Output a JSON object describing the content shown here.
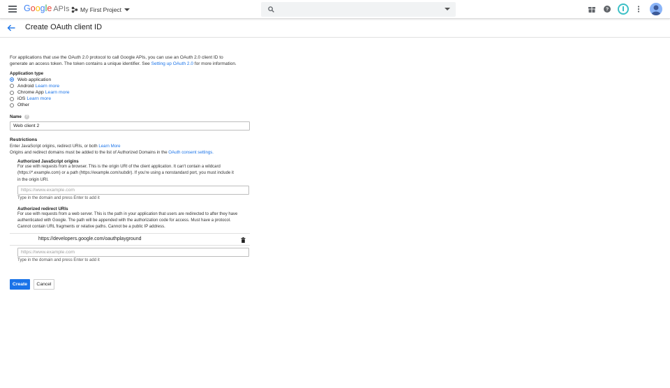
{
  "header": {
    "logo_text": "Google",
    "logo_suffix": "APIs",
    "project_name": "My First Project",
    "icons": [
      "menu-icon",
      "project-icon",
      "search-icon",
      "gift-icon",
      "help-icon",
      "notification-icon",
      "more-vert-icon",
      "avatar"
    ]
  },
  "page": {
    "title": "Create OAuth client ID"
  },
  "intro": {
    "text1": "For applications that use the OAuth 2.0 protocol to call Google APIs, you can use an OAuth 2.0 client ID to",
    "text2": "generate an access token. The token contains a unique identifier. See ",
    "link": "Setting up OAuth 2.0",
    "text3": " for more information."
  },
  "application_type": {
    "label": "Application type",
    "selected": "Web application",
    "options": [
      {
        "label": "Web application",
        "link": ""
      },
      {
        "label": "Android ",
        "link": "Learn more"
      },
      {
        "label": "Chrome App ",
        "link": "Learn more"
      },
      {
        "label": "iOS ",
        "link": "Learn more"
      },
      {
        "label": "Other",
        "link": ""
      }
    ]
  },
  "name": {
    "label": "Name",
    "value": "Web client 2"
  },
  "restrictions": {
    "title": "Restrictions",
    "line1": "Enter JavaScript origins, redirect URIs, or both ",
    "line1_link": "Learn More",
    "line2": "Origins and redirect domains must be added to the list of Authorized Domains in the ",
    "line2_link": "OAuth consent settings.",
    "js_origins": {
      "title": "Authorized JavaScript origins",
      "desc1": "For use with requests from a browser. This is the origin URI of the client application. It can't contain a wildcard",
      "desc2": "(https://*.example.com) or a path (https://example.com/subdir). If you're using a nonstandard port, you must include it",
      "desc3": "in the origin URI.",
      "placeholder": "https://www.example.com",
      "hint": "Type in the domain and press Enter to add it"
    },
    "redirect_uris": {
      "title": "Authorized redirect URIs",
      "desc1": "For use with requests from a web server. This is the path in your application that users are redirected to after they have",
      "desc2": "authenticated with Google. The path will be appended with the authorization code for access. Must have a protocol.",
      "desc3": "Cannot contain URL fragments or relative paths. Cannot be a public IP address.",
      "entries": [
        "https://developers.google.com/oauthplayground"
      ],
      "placeholder": "https://www.example.com",
      "hint": "Type in the domain and press Enter to add it"
    }
  },
  "actions": {
    "create": "Create",
    "cancel": "Cancel"
  },
  "colors": {
    "accent": "#1a73e8",
    "ring": "#3cc0c6"
  }
}
